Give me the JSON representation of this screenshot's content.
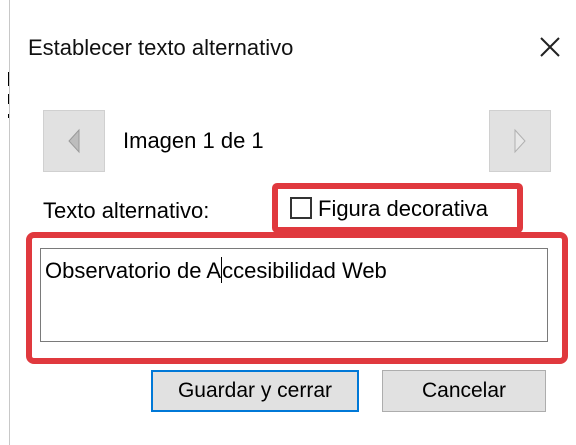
{
  "dialog": {
    "title": "Establecer texto alternativo",
    "close_icon": "close-icon"
  },
  "navigator": {
    "prev_icon": "triangle-left-icon",
    "next_icon": "triangle-right-icon",
    "counter_text": "Imagen 1 de 1"
  },
  "alt_text": {
    "label": "Texto alternativo:",
    "decorative_label": "Figura decorativa",
    "decorative_checked": false,
    "value_before_caret": "Observatorio de A",
    "value_after_caret": "ccesibilidad Web"
  },
  "buttons": {
    "save_label": "Guardar y cerrar",
    "cancel_label": "Cancelar"
  },
  "colors": {
    "highlight": "#e0393e",
    "focus_border": "#0078d7",
    "button_bg": "#e1e1e1"
  }
}
